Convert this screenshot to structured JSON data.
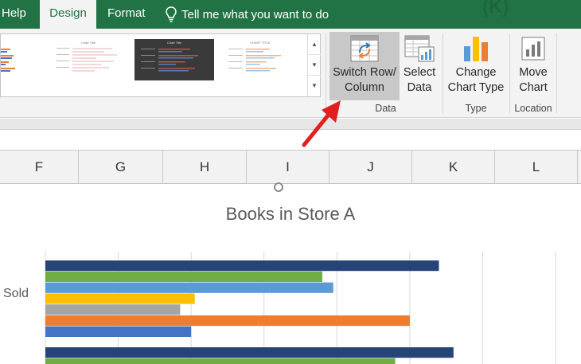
{
  "tabs": {
    "help": "Help",
    "design": "Design",
    "format": "Format",
    "tell_me": "Tell me what you want to do"
  },
  "gallery": {
    "thumb_titles": [
      "Chart Title",
      "Chart Title",
      "Chart Title",
      "CHART TITLE"
    ]
  },
  "ribbon": {
    "switch_row_column": {
      "line1": "Switch Row/",
      "line2": "Column"
    },
    "select_data": {
      "line1": "Select",
      "line2": "Data"
    },
    "change_chart_type": {
      "line1": "Change",
      "line2": "Chart Type"
    },
    "move_chart": {
      "line1": "Move",
      "line2": "Chart"
    },
    "groups": {
      "data": "Data",
      "type": "Type",
      "location": "Location"
    }
  },
  "columns": [
    "F",
    "G",
    "H",
    "I",
    "J",
    "K",
    "L"
  ],
  "chart_data": {
    "type": "bar",
    "title": "Books in Store A",
    "visible_category_fragment": "Sold",
    "series_colors": [
      "#264478",
      "#70ad47",
      "#5b9bd5",
      "#ffc000",
      "#a5a5a5",
      "#ed7d31",
      "#4472c4"
    ],
    "groups": [
      {
        "label": "Sold",
        "values": [
          540,
          380,
          395,
          205,
          185,
          500,
          200
        ]
      },
      {
        "label": "",
        "values": [
          560,
          480
        ]
      }
    ],
    "xlim": [
      0,
      700
    ]
  },
  "colors": {
    "excel_green": "#217346",
    "accent_arrow": "#e02020"
  }
}
